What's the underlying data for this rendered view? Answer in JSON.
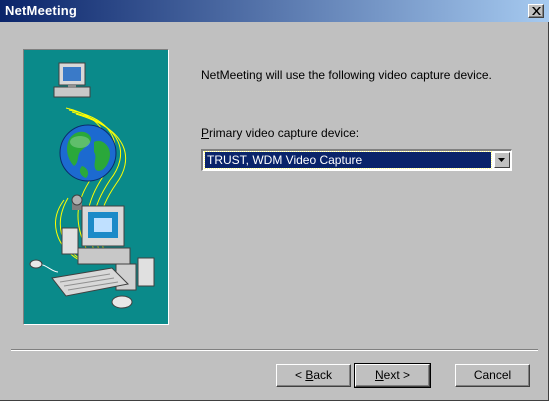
{
  "window": {
    "title": "NetMeeting",
    "close_glyph": "x"
  },
  "content": {
    "intro_text": "NetMeeting will use the following video capture device.",
    "device_label_accel": "P",
    "device_label_rest": "rimary video capture device:",
    "device_selected": "TRUST, WDM Video Capture"
  },
  "buttons": {
    "back_prefix": "< ",
    "back_accel": "B",
    "back_rest": "ack",
    "next_accel": "N",
    "next_rest": "ext >",
    "cancel_label": "Cancel"
  },
  "icons": {
    "illustration": "network-computers-globe-illustration",
    "dropdown": "chevron-down-icon",
    "close": "close-icon"
  },
  "colors": {
    "titlebar": "#0a246a",
    "illustration_bg": "#0a8a8a",
    "selection": "#0a246a",
    "face": "#c0c0c0"
  }
}
